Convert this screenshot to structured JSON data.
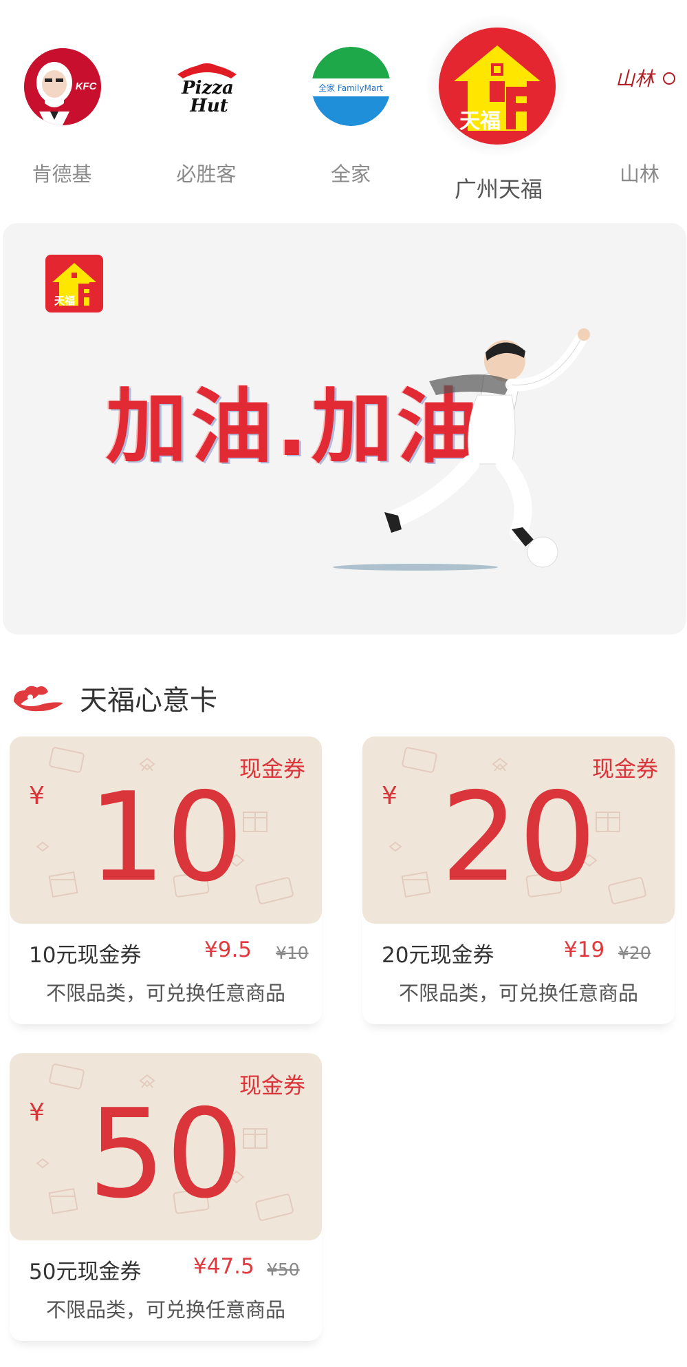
{
  "brands": [
    {
      "name": "肯德基",
      "logo_text": "KFC"
    },
    {
      "name": "必胜客",
      "logo_text": "Pizza Hut"
    },
    {
      "name": "全家",
      "logo_text": "全家 FamilyMart"
    },
    {
      "name": "广州天福",
      "logo_text": "天福",
      "active": true
    },
    {
      "name": "山林",
      "logo_text": "山林"
    }
  ],
  "banner": {
    "logo_text": "天福",
    "slogan": "加油.加油!"
  },
  "section": {
    "title": "天福心意卡",
    "icon": "cloud-icon"
  },
  "cards": [
    {
      "tag": "现金券",
      "currency": "¥",
      "amount": "10",
      "title": "10元现金券",
      "price": "¥9.5",
      "original_price": "¥10",
      "desc": "不限品类，可兑换任意商品"
    },
    {
      "tag": "现金券",
      "currency": "¥",
      "amount": "20",
      "title": "20元现金券",
      "price": "¥19",
      "original_price": "¥20",
      "desc": "不限品类，可兑换任意商品"
    },
    {
      "tag": "现金券",
      "currency": "¥",
      "amount": "50",
      "title": "50元现金券",
      "price": "¥47.5",
      "original_price": "¥50",
      "desc": "不限品类，可兑换任意商品"
    }
  ],
  "colors": {
    "accent_red": "#d9353a",
    "card_face": "#f0e5d9",
    "tianfu_red": "#e3262f",
    "tianfu_yellow": "#ffe600"
  }
}
